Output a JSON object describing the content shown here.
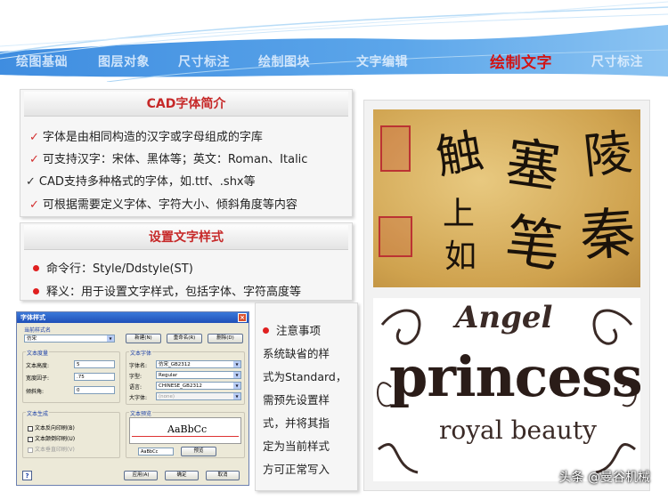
{
  "nav": {
    "items": [
      "绘图基础",
      "图层对象",
      "尺寸标注",
      "绘制图块",
      "文字编辑",
      "绘制文字",
      "尺寸标注"
    ],
    "active_label": "绘制文字"
  },
  "font_intro": {
    "title": "CAD字体简介",
    "lines": [
      "字体是由相同构造的汉字或字母组成的字库",
      "可支持汉字：宋体、黑体等；英文：Roman、Italic",
      "CAD支持多种格式的字体，如.ttf、.shx等",
      "可根据需要定义字体、字符大小、倾斜角度等内容"
    ]
  },
  "text_style": {
    "title": "设置文字样式",
    "lines": [
      "命令行：Style/Ddstyle(ST)",
      "释义：用于设置文字样式，包括字体、字符高度等"
    ]
  },
  "dialog": {
    "title": "字体样式",
    "close": "×",
    "current_style_label": "当前样式名",
    "current_style_value": "仿宋",
    "btn_new": "新建(N)",
    "btn_rename": "重命名(R)",
    "btn_delete": "删除(D)",
    "text_measure_label": "文本度量",
    "height_label": "文本高度:",
    "height_value": "5",
    "width_factor_label": "宽度因子:",
    "width_factor_value": ".75",
    "oblique_label": "倾斜角:",
    "oblique_value": "0",
    "text_font_label": "文本字体",
    "font_name_label": "字体名:",
    "font_name_value": "仿宋_GB2312",
    "style_label": "字型:",
    "style_value": "Regular",
    "lang_label": "语言:",
    "lang_value": "CHINESE_GB2312",
    "big_font_label": "大字体:",
    "big_font_value": "(none)",
    "gen_label": "文本生成",
    "chk_backward": "文本反向印刷(B)",
    "chk_upside": "文本颠倒印刷(U)",
    "chk_vertical": "文本垂直印刷(V)",
    "preview_label": "文本预览",
    "preview_text": "AaBbCc",
    "preview_input": "AaBbCc",
    "btn_preview": "预览",
    "help": "?",
    "btn_apply": "应用(A)",
    "btn_ok": "确定",
    "btn_cancel": "取消"
  },
  "note": {
    "lines": [
      "注意事项",
      "系统缺省的样",
      "式为Standard，",
      "需预先设置样",
      "式，并将其指",
      "定为当前样式",
      "方可正常写入"
    ]
  },
  "images": {
    "calligraphy_chars": [
      "陵",
      "塞",
      "秦",
      "笔",
      "触",
      "上",
      "如"
    ],
    "gothic_top": "Angel",
    "gothic_main": "princess",
    "gothic_sub": "royal beauty"
  },
  "watermark": "头条 @曼谷机械",
  "colors": {
    "accent_red": "#d21414",
    "header_blue": "#3d8fe0"
  }
}
